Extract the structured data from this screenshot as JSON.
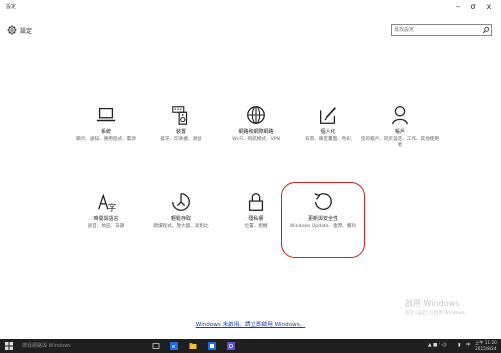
{
  "window": {
    "app_title": "設定",
    "minimize": "–",
    "maximize": "σ",
    "close": "x"
  },
  "header": {
    "title": "設定"
  },
  "search": {
    "placeholder": "尋找設定"
  },
  "tiles": [
    {
      "name": "系統",
      "desc": "顯示、通知、應用程式、電源",
      "icon": "laptop-icon"
    },
    {
      "name": "裝置",
      "desc": "藍牙、印表機、滑鼠",
      "icon": "speaker-keyboard-icon"
    },
    {
      "name": "網路和網際網路",
      "desc": "Wi-Fi、飛航模式、VPN",
      "icon": "globe-icon"
    },
    {
      "name": "個人化",
      "desc": "背景、鎖定畫面、色彩",
      "icon": "paint-icon"
    },
    {
      "name": "帳戶",
      "desc": "您的帳戶、同步設定、工作、其他使用者",
      "icon": "person-icon"
    },
    {
      "name": "時間與語言",
      "desc": "語音、地區、日期",
      "icon": "time-language-icon"
    },
    {
      "name": "輕鬆存取",
      "desc": "朗讀程式、放大鏡、高對比",
      "icon": "ease-of-access-icon"
    },
    {
      "name": "隱私權",
      "desc": "位置、相機",
      "icon": "lock-icon"
    },
    {
      "name": "更新與安全性",
      "desc": "Windows Update、復原、備份",
      "icon": "update-icon"
    }
  ],
  "footer": {
    "link": "Windows 未啟用。請立即啟用 Windows。"
  },
  "watermark": {
    "line1": "啟用 Windows",
    "line2": "移至 [設定] 以啟用 Windows。"
  },
  "taskbar": {
    "search": "搜尋網路與 Windows",
    "ime": "中",
    "time": "上午 11:20",
    "date": "2015/8/24"
  },
  "colors": {
    "highlight": "#d01f1f",
    "taskbar": "#1f1f1f",
    "link": "#1a3fa6"
  }
}
